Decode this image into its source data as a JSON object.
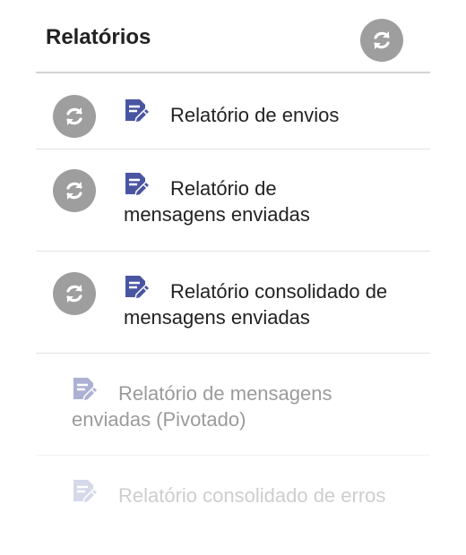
{
  "header": {
    "title": "Relatórios",
    "refresh_icon": "refresh-icon"
  },
  "reports": [
    {
      "label": "Relatório de envios",
      "has_refresh": true
    },
    {
      "label": "Relatório de mensagens enviadas",
      "has_refresh": true
    },
    {
      "label": "Relatório consolidado de mensagens enviadas",
      "has_refresh": true
    },
    {
      "label": "Relatório de mensagens enviadas (Pivotado)",
      "has_refresh": false
    },
    {
      "label": "Relatório consolidado de erros",
      "has_refresh": false
    }
  ],
  "colors": {
    "refresh_bg": "#9e9e9e",
    "doc_icon": "#4a55a2",
    "divider": "#d4d4d4"
  }
}
